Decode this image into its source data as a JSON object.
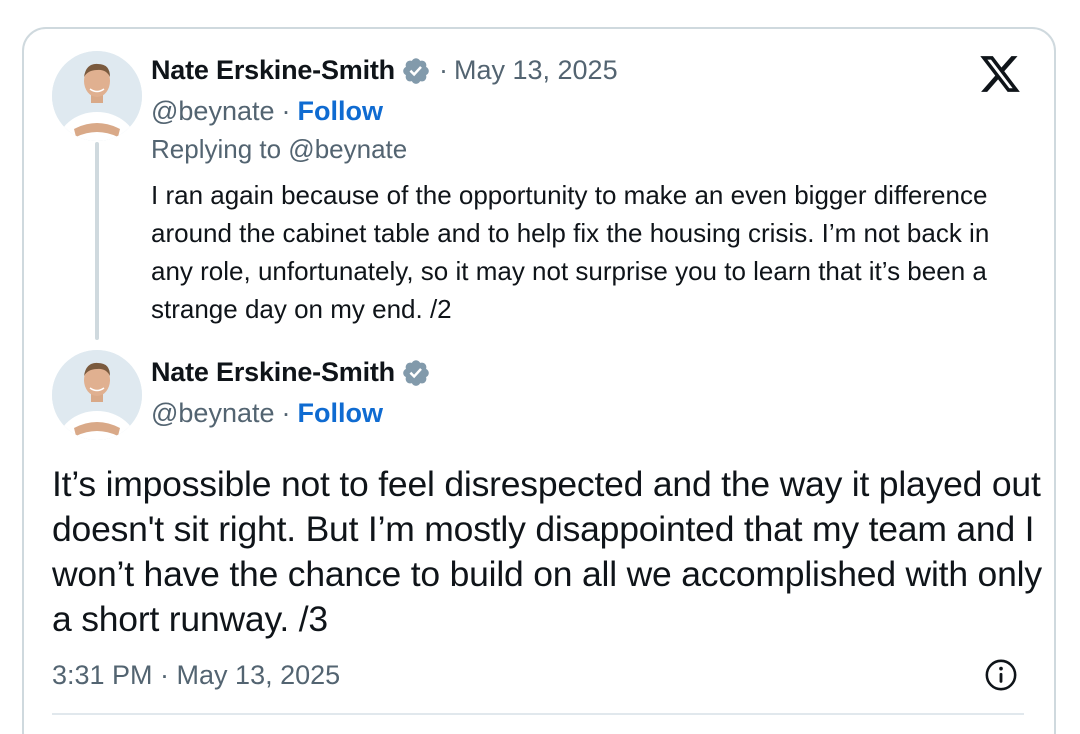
{
  "reply_tweet": {
    "author_name": "Nate Erskine-Smith",
    "separator": "·",
    "date": "May 13, 2025",
    "handle": "@beynate",
    "follow_label": "Follow",
    "replying_to": "Replying to @beynate",
    "text": "I ran again because of the opportunity to make an even bigger difference around the cabinet table and to help fix the housing crisis. I’m not back in any role, unfortunately, so it may not surprise you to learn that it’s been a strange day on my end. /2"
  },
  "main_tweet": {
    "author_name": "Nate Erskine-Smith",
    "handle": "@beynate",
    "follow_label": "Follow",
    "text": "It’s impossible not to feel disrespected and the way it played out doesn't sit right. But I’m mostly disappointed that my team and I won’t have the chance to build on all we accomplished with only a short runway. /3",
    "timestamp": "3:31 PM · May 13, 2025"
  },
  "icons": {
    "brand": "x-logo-icon",
    "verified": "verified-badge-icon",
    "info": "info-icon"
  },
  "colors": {
    "follow_link": "#0f6bd1",
    "secondary_text": "#536471",
    "verified_badge": "#829aab",
    "card_border": "#cfd9de"
  }
}
